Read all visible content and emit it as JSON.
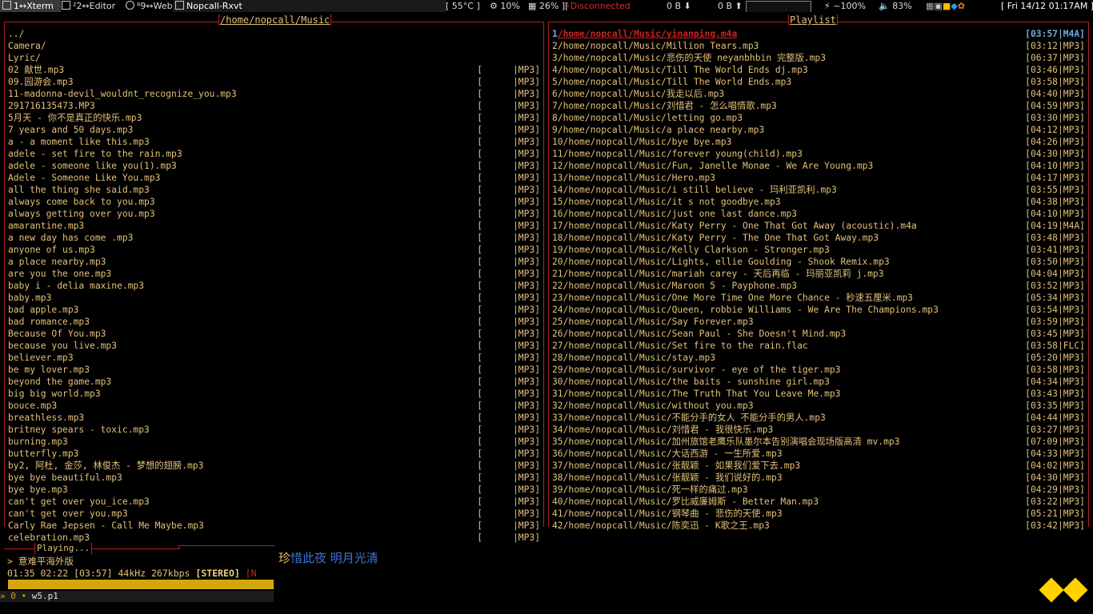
{
  "topbar": {
    "tags": [
      {
        "label": "1↔Xterm",
        "active": true
      },
      {
        "label": "²2↔Editor",
        "active": false
      },
      {
        "label": "⁸9↔Web",
        "active": false
      }
    ],
    "window_title": "Nopcall-Rxvt",
    "temperature": "55°C",
    "cpu": "10%",
    "mem": "26%",
    "net_status": "Disconnected",
    "down": "0 B",
    "up": "0 B",
    "battery": "~100%",
    "volume": "83%",
    "datetime": "Fri 14/12 01:17AM"
  },
  "browser": {
    "title": "/home/nopcall/Music",
    "dirs": [
      "../",
      "Camera/",
      "Lyric/"
    ],
    "files": [
      "02 献世.mp3",
      "09.园游会.mp3",
      "11-madonna-devil_wouldnt_recognize_you.mp3",
      "291716135473.MP3",
      "5月天 - 你不是真正的快乐.mp3",
      "7 years and 50 days.mp3",
      "a - a moment like this.mp3",
      "adele - set fire to the rain.mp3",
      "adele - someone like you(1).mp3",
      "Adele - Someone Like You.mp3",
      "all the thing she said.mp3",
      "always come back to you.mp3",
      "always getting over you.mp3",
      "amarantine.mp3",
      "a new day has come .mp3",
      "anyone of us.mp3",
      "a place nearby.mp3",
      "are you the one.mp3",
      "baby i - delia maxine.mp3",
      "baby.mp3",
      "bad apple.mp3",
      "bad romance.mp3",
      "Because Of You.mp3",
      "because you live.mp3",
      "believer.mp3",
      "be my lover.mp3",
      "beyond the game.mp3",
      "big big world.mp3",
      "bouce.mp3",
      "breathless.mp3",
      "britney spears - toxic.mp3",
      "burning.mp3",
      "butterfly.mp3",
      "by2, 阿杜, 金莎, 林俊杰 - 梦想的翅膀.mp3",
      "bye bye beautiful.mp3",
      "bye bye.mp3",
      "can't get over you_ice.mp3",
      "can't get over you.mp3",
      "Carly Rae Jepsen - Call Me Maybe.mp3",
      "celebration.mp3"
    ],
    "format_tag": "|MP3]",
    "bracket": "["
  },
  "playlist": {
    "title": "Playlist",
    "items": [
      {
        "n": "1",
        "path": "/home/nopcall/Music/yinanping.m4a",
        "dur": "[03:57|M4A]"
      },
      {
        "n": "2",
        "path": "/home/nopcall/Music/Million Tears.mp3",
        "dur": "[03:12|MP3]"
      },
      {
        "n": "3",
        "path": "/home/nopcall/Music/悲伤的天使 neyanbhbin 完整版.mp3",
        "dur": "[06:37|MP3]"
      },
      {
        "n": "4",
        "path": "/home/nopcall/Music/Till The World Ends dj.mp3",
        "dur": "[03:46|MP3]"
      },
      {
        "n": "5",
        "path": "/home/nopcall/Music/Till The World Ends.mp3",
        "dur": "[03:58|MP3]"
      },
      {
        "n": "6",
        "path": "/home/nopcall/Music/我走以后.mp3",
        "dur": "[04:40|MP3]"
      },
      {
        "n": "7",
        "path": "/home/nopcall/Music/刘惜君 - 怎么唱情歌.mp3",
        "dur": "[04:59|MP3]"
      },
      {
        "n": "8",
        "path": "/home/nopcall/Music/letting go.mp3",
        "dur": "[03:30|MP3]"
      },
      {
        "n": "9",
        "path": "/home/nopcall/Music/a place nearby.mp3",
        "dur": "[04:12|MP3]"
      },
      {
        "n": "10",
        "path": "/home/nopcall/Music/bye bye.mp3",
        "dur": "[04:26|MP3]"
      },
      {
        "n": "11",
        "path": "/home/nopcall/Music/forever young(child).mp3",
        "dur": "[04:30|MP3]"
      },
      {
        "n": "12",
        "path": "/home/nopcall/Music/Fun, Janelle Monae - We Are Young.mp3",
        "dur": "[04:10|MP3]"
      },
      {
        "n": "13",
        "path": "/home/nopcall/Music/Hero.mp3",
        "dur": "[04:17|MP3]"
      },
      {
        "n": "14",
        "path": "/home/nopcall/Music/i still believe - 玛利亚凯利.mp3",
        "dur": "[03:55|MP3]"
      },
      {
        "n": "15",
        "path": "/home/nopcall/Music/it s not goodbye.mp3",
        "dur": "[04:38|MP3]"
      },
      {
        "n": "16",
        "path": "/home/nopcall/Music/just one last dance.mp3",
        "dur": "[04:10|MP3]"
      },
      {
        "n": "17",
        "path": "/home/nopcall/Music/Katy Perry - One That Got Away (acoustic).m4a",
        "dur": "[04:19|M4A]"
      },
      {
        "n": "18",
        "path": "/home/nopcall/Music/Katy Perry - The One That Got Away.mp3",
        "dur": "[03:48|MP3]"
      },
      {
        "n": "19",
        "path": "/home/nopcall/Music/Kelly Clarkson - Stronger.mp3",
        "dur": "[03:41|MP3]"
      },
      {
        "n": "20",
        "path": "/home/nopcall/Music/Lights, ellie Goulding - Shook Remix.mp3",
        "dur": "[03:50|MP3]"
      },
      {
        "n": "21",
        "path": "/home/nopcall/Music/mariah carey - 天后再临 - 玛丽亚凯莉 j.mp3",
        "dur": "[04:04|MP3]"
      },
      {
        "n": "22",
        "path": "/home/nopcall/Music/Maroon 5 - Payphone.mp3",
        "dur": "[03:52|MP3]"
      },
      {
        "n": "23",
        "path": "/home/nopcall/Music/One More Time One More Chance - 秒速五厘米.mp3",
        "dur": "[05:34|MP3]"
      },
      {
        "n": "24",
        "path": "/home/nopcall/Music/Queen, robbie Williams - We Are The Champions.mp3",
        "dur": "[03:54|MP3]"
      },
      {
        "n": "25",
        "path": "/home/nopcall/Music/Say Forever.mp3",
        "dur": "[03:59|MP3]"
      },
      {
        "n": "26",
        "path": "/home/nopcall/Music/Sean Paul - She Doesn't Mind.mp3",
        "dur": "[03:45|MP3]"
      },
      {
        "n": "27",
        "path": "/home/nopcall/Music/Set fire to the rain.flac",
        "dur": "[03:58|FLC]"
      },
      {
        "n": "28",
        "path": "/home/nopcall/Music/stay.mp3",
        "dur": "[05:20|MP3]"
      },
      {
        "n": "29",
        "path": "/home/nopcall/Music/survivor - eye of the tiger.mp3",
        "dur": "[03:58|MP3]"
      },
      {
        "n": "30",
        "path": "/home/nopcall/Music/the baits - sunshine girl.mp3",
        "dur": "[04:34|MP3]"
      },
      {
        "n": "31",
        "path": "/home/nopcall/Music/The Truth That You Leave Me.mp3",
        "dur": "[03:43|MP3]"
      },
      {
        "n": "32",
        "path": "/home/nopcall/Music/without you.mp3",
        "dur": "[03:35|MP3]"
      },
      {
        "n": "33",
        "path": "/home/nopcall/Music/不能分手的女人 不能分手的男人.mp3",
        "dur": "[04:44|MP3]"
      },
      {
        "n": "34",
        "path": "/home/nopcall/Music/刘惜君 - 我很快乐.mp3",
        "dur": "[03:27|MP3]"
      },
      {
        "n": "35",
        "path": "/home/nopcall/Music/加州旅馆老鹰乐队墨尔本告别演唱会现场版高清 mv.mp3",
        "dur": "[07:09|MP3]"
      },
      {
        "n": "36",
        "path": "/home/nopcall/Music/大话西游 - 一生所爱.mp3",
        "dur": "[04:33|MP3]"
      },
      {
        "n": "37",
        "path": "/home/nopcall/Music/张靓颖 - 如果我们爱下去.mp3",
        "dur": "[04:02|MP3]"
      },
      {
        "n": "38",
        "path": "/home/nopcall/Music/张靓颖 - 我们说好的.mp3",
        "dur": "[04:30|MP3]"
      },
      {
        "n": "39",
        "path": "/home/nopcall/Music/死一样的痛过.mp3",
        "dur": "[04:29|MP3]"
      },
      {
        "n": "40",
        "path": "/home/nopcall/Music/罗比威廉姆斯 - Better Man.mp3",
        "dur": "[03:22|MP3]"
      },
      {
        "n": "41",
        "path": "/home/nopcall/Music/钢琴曲 - 悲伤的天使.mp3",
        "dur": "[05:21|MP3]"
      },
      {
        "n": "42",
        "path": "/home/nopcall/Music/陈奕迅 - K歌之王.mp3",
        "dur": "[03:42|MP3]"
      }
    ]
  },
  "playing": {
    "title": "Playing...",
    "current": "> 意难平海外版",
    "status": "01:35 02:22 [03:57]   44kHz  267kbps",
    "stereo": "[STEREO]",
    "flag": "[N",
    "progress": 0.4
  },
  "lyric": {
    "first": "珍",
    "rest": "惜此夜  明月光清"
  },
  "tmux": {
    "prefix": "» 0 •",
    "name": "w5.p1"
  },
  "colors": {
    "accent": "#b22222",
    "text": "#e4c07a",
    "progress": "#d4a70c",
    "highlight": "#6fa8dc"
  }
}
